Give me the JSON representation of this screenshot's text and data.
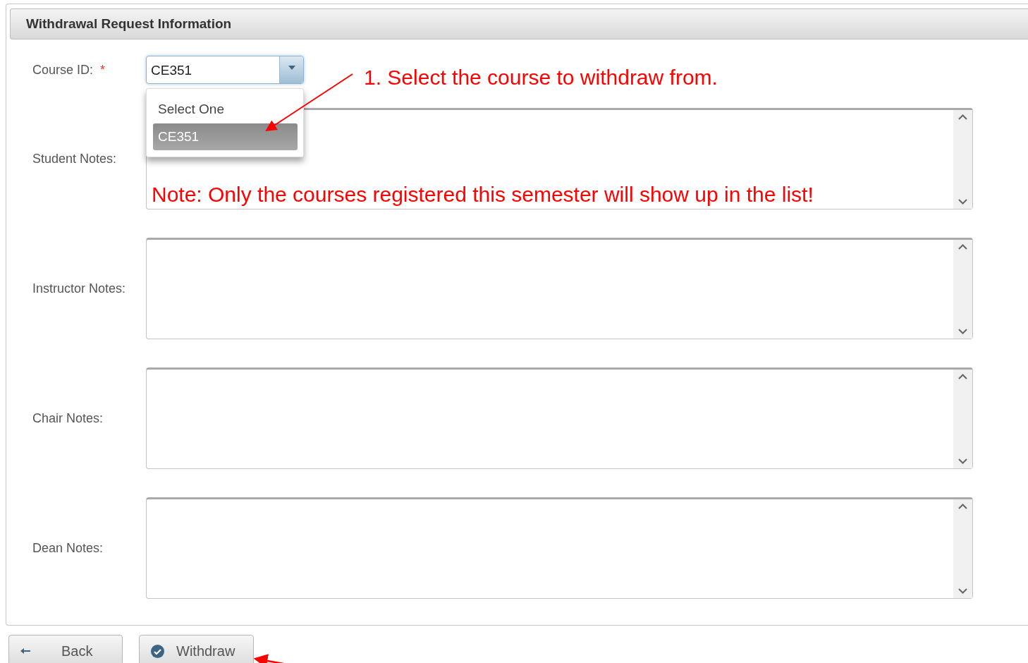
{
  "panel": {
    "title": "Withdrawal Request Information"
  },
  "course_field": {
    "label": "Course ID:",
    "required_mark": "*",
    "value": "CE351",
    "expanded": true
  },
  "dropdown_options": [
    {
      "label": "Select One",
      "selected": false
    },
    {
      "label": "CE351",
      "selected": true
    }
  ],
  "notes_fields": [
    {
      "label": "Student Notes:"
    },
    {
      "label": "Instructor Notes:"
    },
    {
      "label": "Chair Notes:"
    },
    {
      "label": "Dean Notes:"
    }
  ],
  "buttons": [
    {
      "label": "Back",
      "kind": "back"
    },
    {
      "label": "Withdraw",
      "kind": "confirm"
    }
  ],
  "annotations": [
    {
      "text": "1. Select the course to withdraw from.",
      "kind": "step"
    },
    {
      "text": "Note: Only the courses registered this semester will show up in the list!",
      "kind": "note"
    }
  ]
}
